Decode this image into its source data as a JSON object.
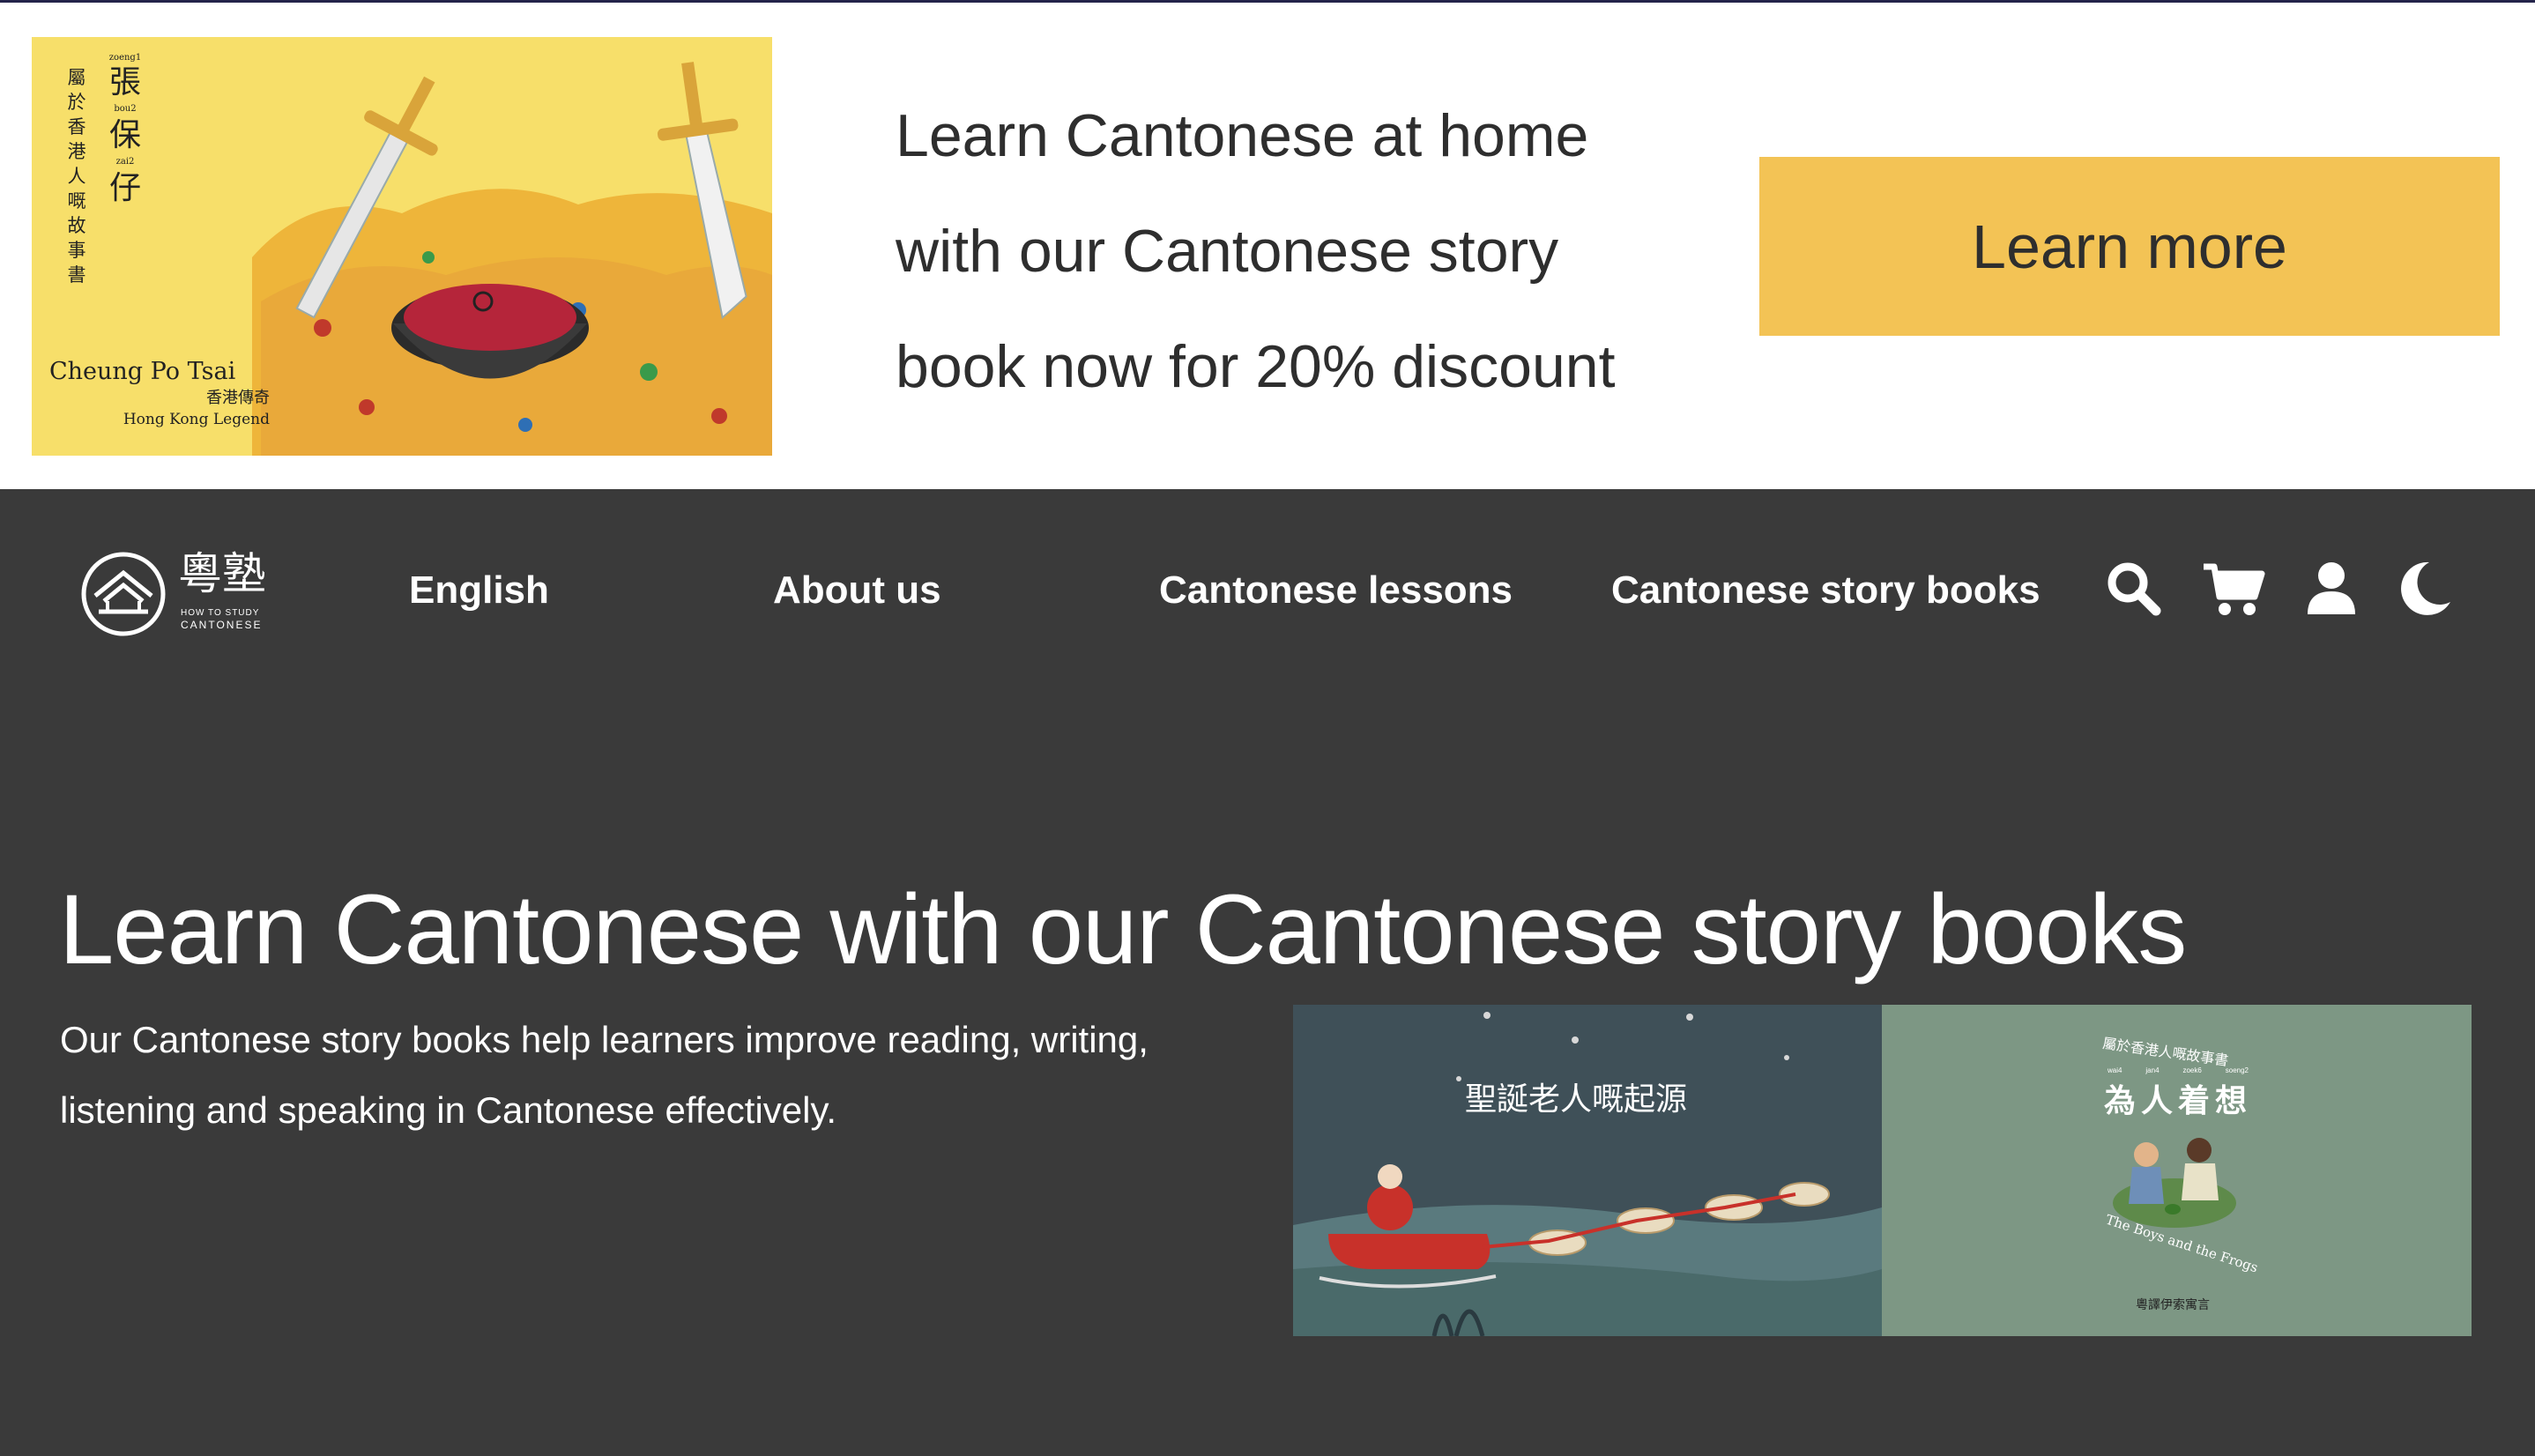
{
  "promo": {
    "image": {
      "vertical_title": "屬於香港人嘅故事書",
      "chars": [
        "張",
        "保",
        "仔"
      ],
      "jyutping": [
        "zoeng1",
        "bou2",
        "zai2"
      ],
      "english_title": "Cheung Po Tsai",
      "chinese_subtitle": "香港傳奇",
      "english_subtitle": "Hong Kong Legend"
    },
    "lines": [
      "Learn Cantonese at home",
      "with our Cantonese story",
      "book now for 20% discount"
    ],
    "button_label": "Learn more",
    "button_color": "#f3c355"
  },
  "nav": {
    "logo": {
      "chinese": "粵塾",
      "line1": "HOW TO STUDY",
      "line2": "CANTONESE"
    },
    "links": [
      "English",
      "About us",
      "Cantonese lessons",
      "Cantonese story books"
    ],
    "icons": [
      "search-icon",
      "cart-icon",
      "user-icon",
      "dark-mode-icon"
    ]
  },
  "hero": {
    "title": "Learn Cantonese with our Cantonese story books",
    "description": "Our Cantonese story books help learners improve reading, writing, listening and speaking in Cantonese effectively."
  },
  "books": [
    {
      "title": "聖誕老人嘅起源"
    },
    {
      "series": "屬於香港人嘅故事書",
      "title": "為人着想",
      "jyutping": [
        "wai4",
        "jan4",
        "zoek6",
        "soeng2"
      ],
      "english": "The Boys and the Frogs",
      "footer": "粵譯伊索寓言"
    }
  ],
  "colors": {
    "background": "#3a3a3a",
    "promo_background": "#ffffff",
    "accent": "#f3c355"
  }
}
